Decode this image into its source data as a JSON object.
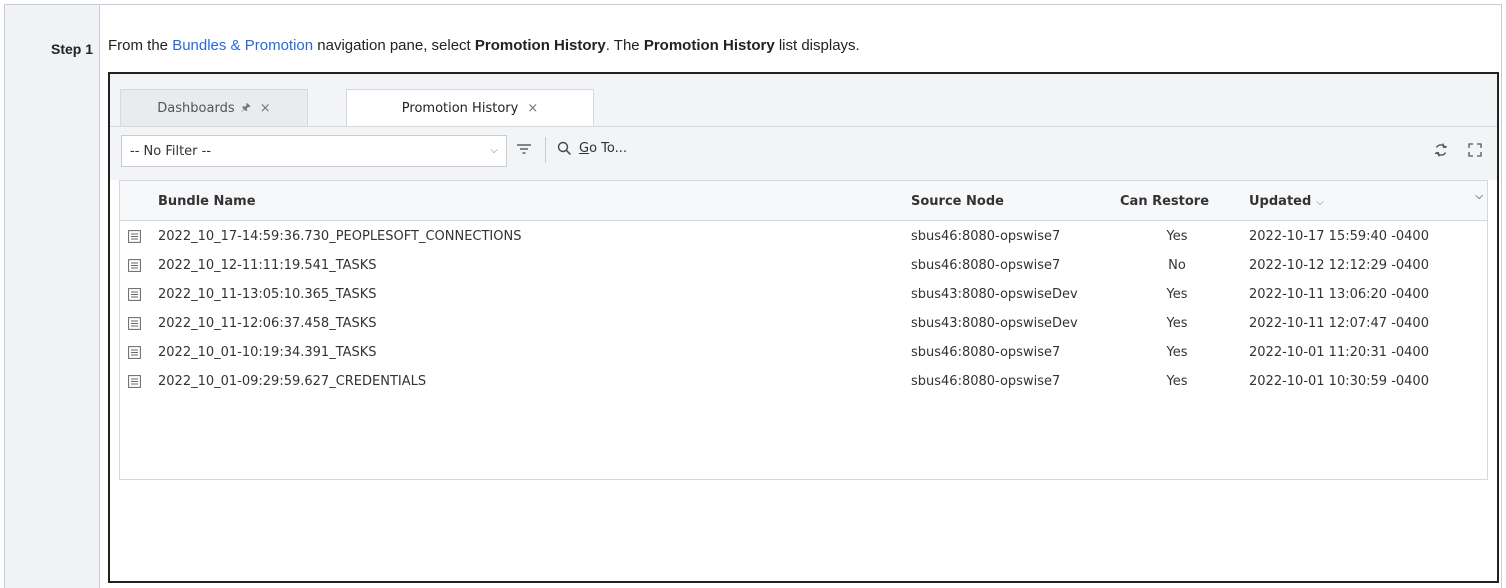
{
  "step": {
    "label": "Step 1"
  },
  "instruction": {
    "prefix": "From the ",
    "link": "Bundles & Promotion",
    "middle": " navigation pane, select ",
    "bold1": "Promotion History",
    "middle2": ". The ",
    "bold2": "Promotion History",
    "suffix": " list displays."
  },
  "tabs": [
    {
      "label": "Dashboards",
      "pinned": true,
      "active": false
    },
    {
      "label": "Promotion History",
      "pinned": false,
      "active": true
    }
  ],
  "toolbar": {
    "filter_value": "-- No Filter --",
    "goto_underline": "G",
    "goto_rest": "o To..."
  },
  "grid": {
    "columns": {
      "bundle_name": "Bundle Name",
      "source_node": "Source Node",
      "can_restore": "Can Restore",
      "updated": "Updated"
    },
    "rows": [
      {
        "bundle_name": "2022_10_17-14:59:36.730_PEOPLESOFT_CONNECTIONS",
        "source_node": "sbus46:8080-opswise7",
        "can_restore": "Yes",
        "updated": "2022-10-17 15:59:40 -0400"
      },
      {
        "bundle_name": "2022_10_12-11:11:19.541_TASKS",
        "source_node": "sbus46:8080-opswise7",
        "can_restore": "No",
        "updated": "2022-10-12 12:12:29 -0400"
      },
      {
        "bundle_name": "2022_10_11-13:05:10.365_TASKS",
        "source_node": "sbus43:8080-opswiseDev",
        "can_restore": "Yes",
        "updated": "2022-10-11 13:06:20 -0400"
      },
      {
        "bundle_name": "2022_10_11-12:06:37.458_TASKS",
        "source_node": "sbus43:8080-opswiseDev",
        "can_restore": "Yes",
        "updated": "2022-10-11 12:07:47 -0400"
      },
      {
        "bundle_name": "2022_10_01-10:19:34.391_TASKS",
        "source_node": "sbus46:8080-opswise7",
        "can_restore": "Yes",
        "updated": "2022-10-01 11:20:31 -0400"
      },
      {
        "bundle_name": "2022_10_01-09:29:59.627_CREDENTIALS",
        "source_node": "sbus46:8080-opswise7",
        "can_restore": "Yes",
        "updated": "2022-10-01 10:30:59 -0400"
      }
    ]
  },
  "colors": {
    "link": "#2a6ad6",
    "step_bg": "#f0f2f6",
    "toolbar_bg": "#f3f4f6"
  }
}
